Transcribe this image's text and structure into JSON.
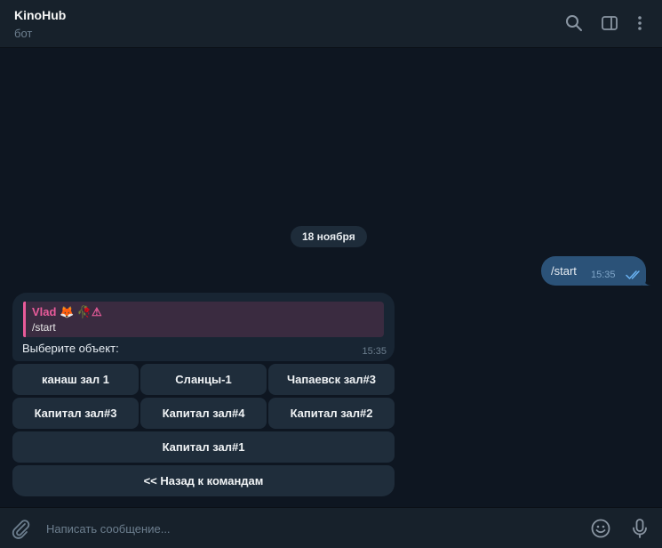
{
  "header": {
    "title": "KinoHub",
    "subtitle": "бот",
    "icons": [
      "search-icon",
      "sidebar-panel-icon",
      "more-vertical-icon"
    ]
  },
  "chat": {
    "date_separator": "18 ноября",
    "outgoing": {
      "text": "/start",
      "time": "15:35",
      "status": "read"
    },
    "incoming": {
      "reply_author": "Vlad 🦊 🥀⚠",
      "reply_text": "/start",
      "text": "Выберите объект:",
      "time": "15:35"
    }
  },
  "keyboard": {
    "rows": [
      [
        "канаш зал 1",
        "Сланцы-1",
        "Чапаевск зал#3"
      ],
      [
        "Капитал зал#3",
        "Капитал зал#4",
        "Капитал зал#2"
      ],
      [
        "Капитал зал#1"
      ],
      [
        "<< Назад к командам"
      ]
    ]
  },
  "composer": {
    "placeholder": "Написать сообщение...",
    "icons": [
      "attach-icon",
      "emoji-icon",
      "microphone-icon"
    ]
  },
  "colors": {
    "background": "#0e1621",
    "panel": "#17212b",
    "outgoing_bubble": "#2b5278",
    "incoming_bubble": "#182533",
    "reply_accent": "#e85b9a",
    "keyboard_button": "#1f2d3b"
  }
}
